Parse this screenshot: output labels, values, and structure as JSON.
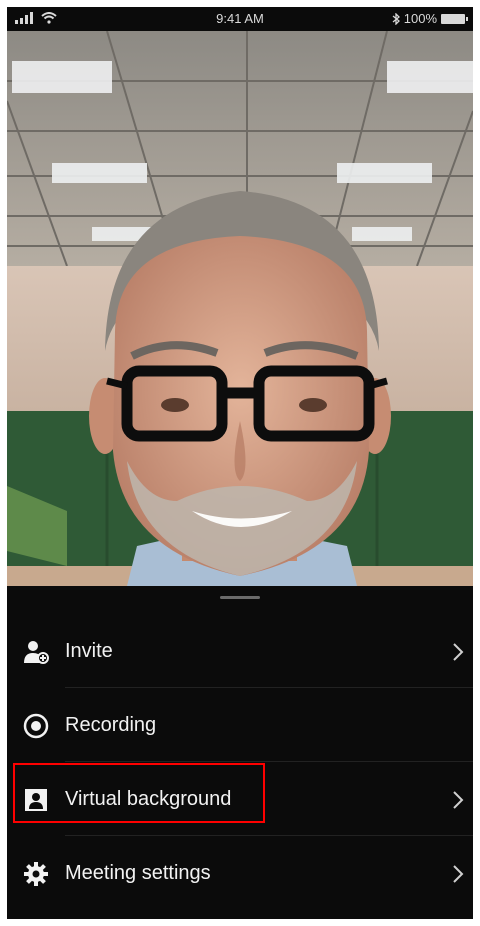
{
  "status_bar": {
    "time": "9:41 AM",
    "battery": "100%"
  },
  "menu": {
    "items": [
      {
        "label": "Invite",
        "icon": "add-person-icon",
        "has_chevron": true
      },
      {
        "label": "Recording",
        "icon": "record-icon",
        "has_chevron": false
      },
      {
        "label": "Virtual background",
        "icon": "virtual-background-icon",
        "has_chevron": true,
        "highlighted": true
      },
      {
        "label": "Meeting settings",
        "icon": "gear-icon",
        "has_chevron": true
      }
    ]
  },
  "colors": {
    "sheet_background": "#0b0b0b",
    "text": "#f2f2f2",
    "highlight": "#ff0000"
  }
}
